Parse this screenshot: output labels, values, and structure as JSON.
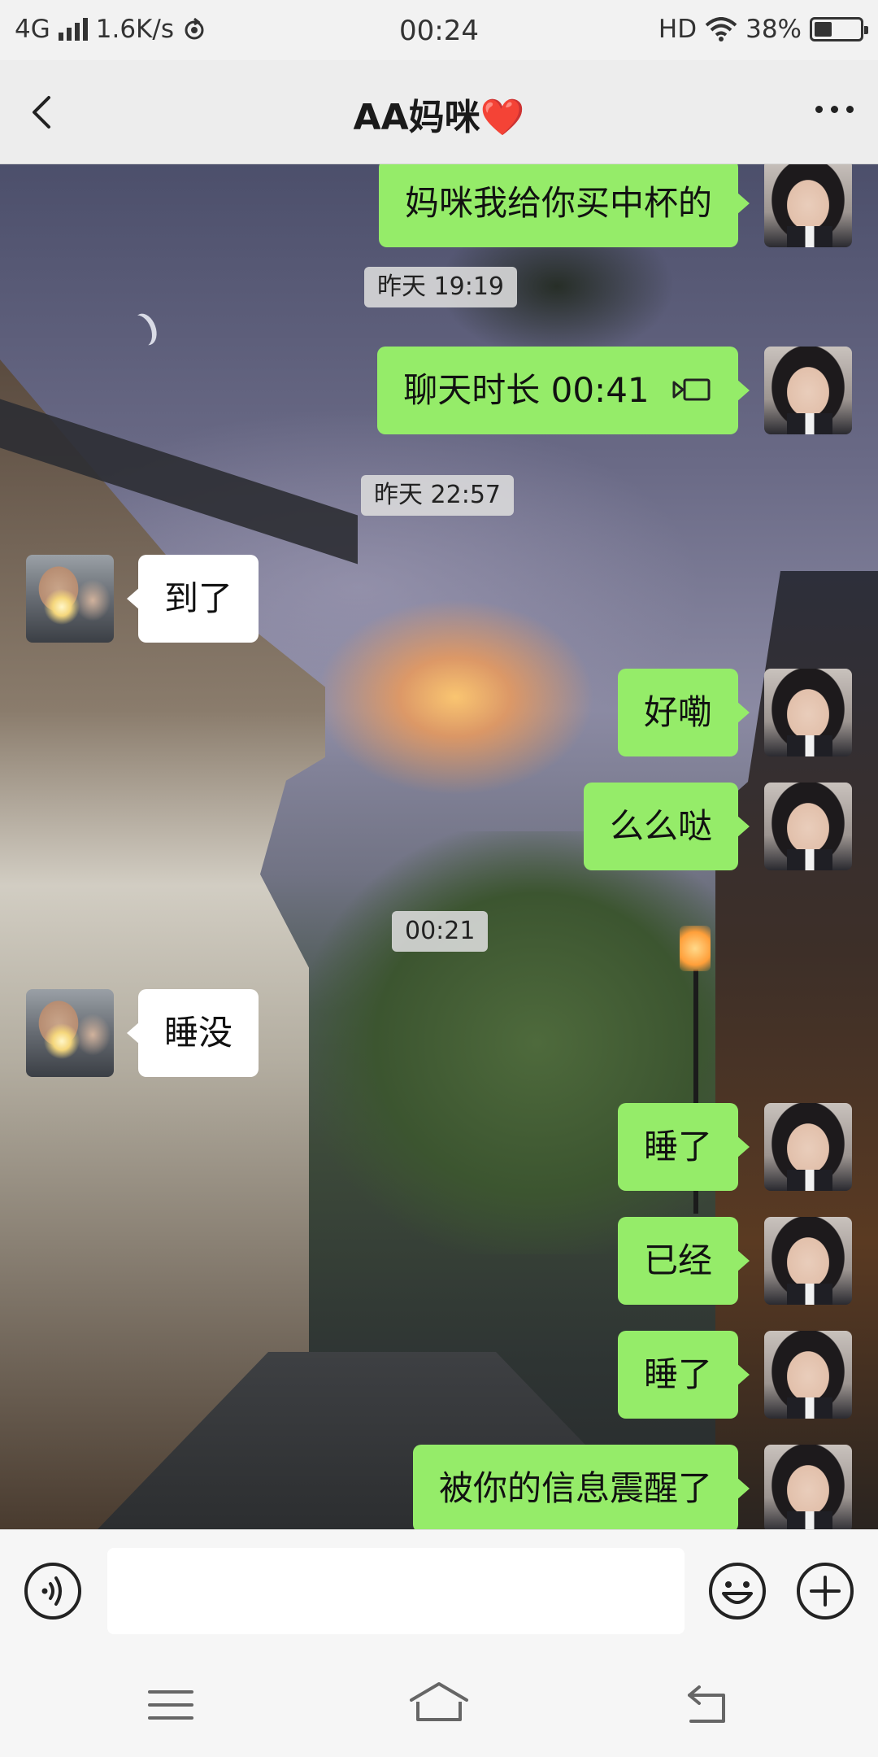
{
  "status_bar": {
    "network": "4G",
    "speed": "1.6K/s",
    "time": "00:24",
    "hd": "HD",
    "battery": "38%",
    "battery_level": 0.38
  },
  "header": {
    "title": "AA妈咪",
    "title_emoji": "❤️"
  },
  "messages": [
    {
      "type": "out",
      "text": "妈咪我给你买中杯的"
    },
    {
      "type": "time",
      "text": "昨天 19:19"
    },
    {
      "type": "out",
      "text": "聊天时长 00:41",
      "icon": "video-call-icon"
    },
    {
      "type": "time",
      "text": "昨天 22:57"
    },
    {
      "type": "in",
      "text": "到了"
    },
    {
      "type": "out",
      "text": "好嘞"
    },
    {
      "type": "out",
      "text": "么么哒"
    },
    {
      "type": "time",
      "text": "00:21"
    },
    {
      "type": "in",
      "text": "睡没"
    },
    {
      "type": "out",
      "text": "睡了"
    },
    {
      "type": "out",
      "text": "已经"
    },
    {
      "type": "out",
      "text": "睡了"
    },
    {
      "type": "out",
      "text": "被你的信息震醒了"
    }
  ],
  "input_bar": {
    "value": "",
    "placeholder": ""
  },
  "colors": {
    "outgoing_bubble": "#95ec69",
    "incoming_bubble": "#ffffff",
    "header_bg": "#ededed",
    "heart": "#e0202a"
  }
}
